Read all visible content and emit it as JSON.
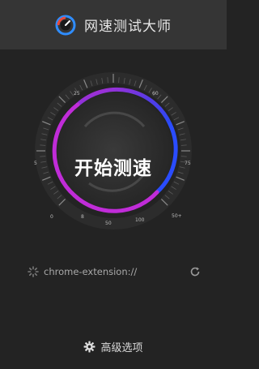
{
  "header": {
    "title": "网速测试大师",
    "logo_icon": "speedometer-logo-icon"
  },
  "gauge": {
    "start_label": "开始测速",
    "scale_labels": [
      "0",
      "5",
      "25",
      "60",
      "75",
      "8",
      "50",
      "100",
      "50+"
    ],
    "arc_colors": [
      "#2a4cff",
      "#c02cd8",
      "#3a7bff"
    ]
  },
  "status": {
    "url_text": "chrome-extension://",
    "spinner_icon": "loading-spinner-icon",
    "refresh_icon": "refresh-icon"
  },
  "footer": {
    "advanced_label": "高级选项",
    "gear_icon": "gear-icon"
  }
}
